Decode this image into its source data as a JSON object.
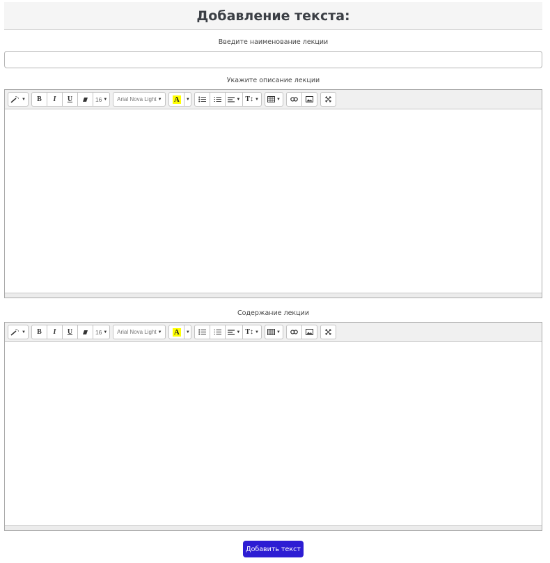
{
  "header": {
    "title": "Добавление текста:"
  },
  "lecture_title": {
    "label": "Введите наименование лекции",
    "value": "",
    "placeholder": ""
  },
  "description_editor": {
    "label": "Укажите описание лекции"
  },
  "content_editor": {
    "label": "Содержание лекции"
  },
  "toolbar": {
    "font_size": "16",
    "font_name": "Arial Nova Light",
    "bold": "B",
    "italic": "I",
    "underline": "U",
    "color_letter": "A",
    "height_label": "T↕",
    "colors": {
      "highlight": "#ffff00"
    }
  },
  "submit": {
    "label": "Добавить текст",
    "color": "#2d1dd3"
  }
}
